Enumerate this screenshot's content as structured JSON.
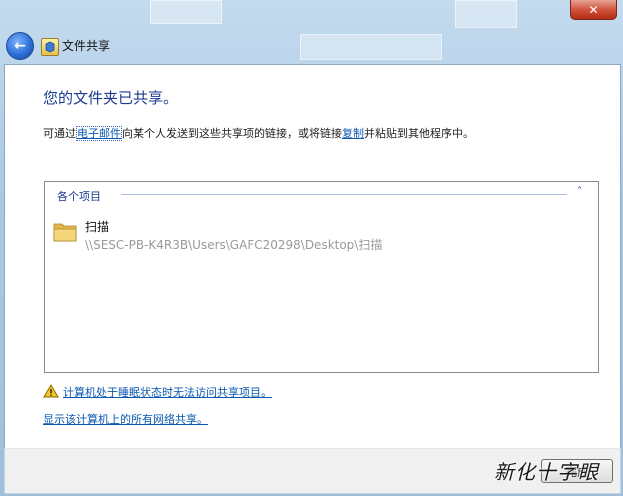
{
  "window": {
    "title": "文件共享",
    "close_glyph": "✕",
    "back_glyph": "←"
  },
  "main": {
    "heading": "您的文件夹已共享。",
    "desc_prefix": "可通过",
    "email_link": "电子邮件",
    "desc_middle": "向某个人发送到这些共享项的链接，或将链接",
    "copy_link": "复制",
    "desc_suffix": "并粘贴到其他程序中。"
  },
  "list": {
    "group_header": "各个项目",
    "toggle_glyph": "˄",
    "items": [
      {
        "name": "扫描",
        "path": "\\\\SESC-PB-K4R3B\\Users\\GAFC20298\\Desktop\\扫描"
      }
    ]
  },
  "warning": {
    "text": "计算机处于睡眠状态时无法访问共享项目。"
  },
  "show_shares_link": "显示该计算机上的所有网络共享。",
  "footer": {
    "done_label": "完成"
  },
  "watermark": "新化十字眼",
  "colors": {
    "heading": "#1c3a8f",
    "link": "#0a58b0",
    "close": "#c8452c"
  }
}
